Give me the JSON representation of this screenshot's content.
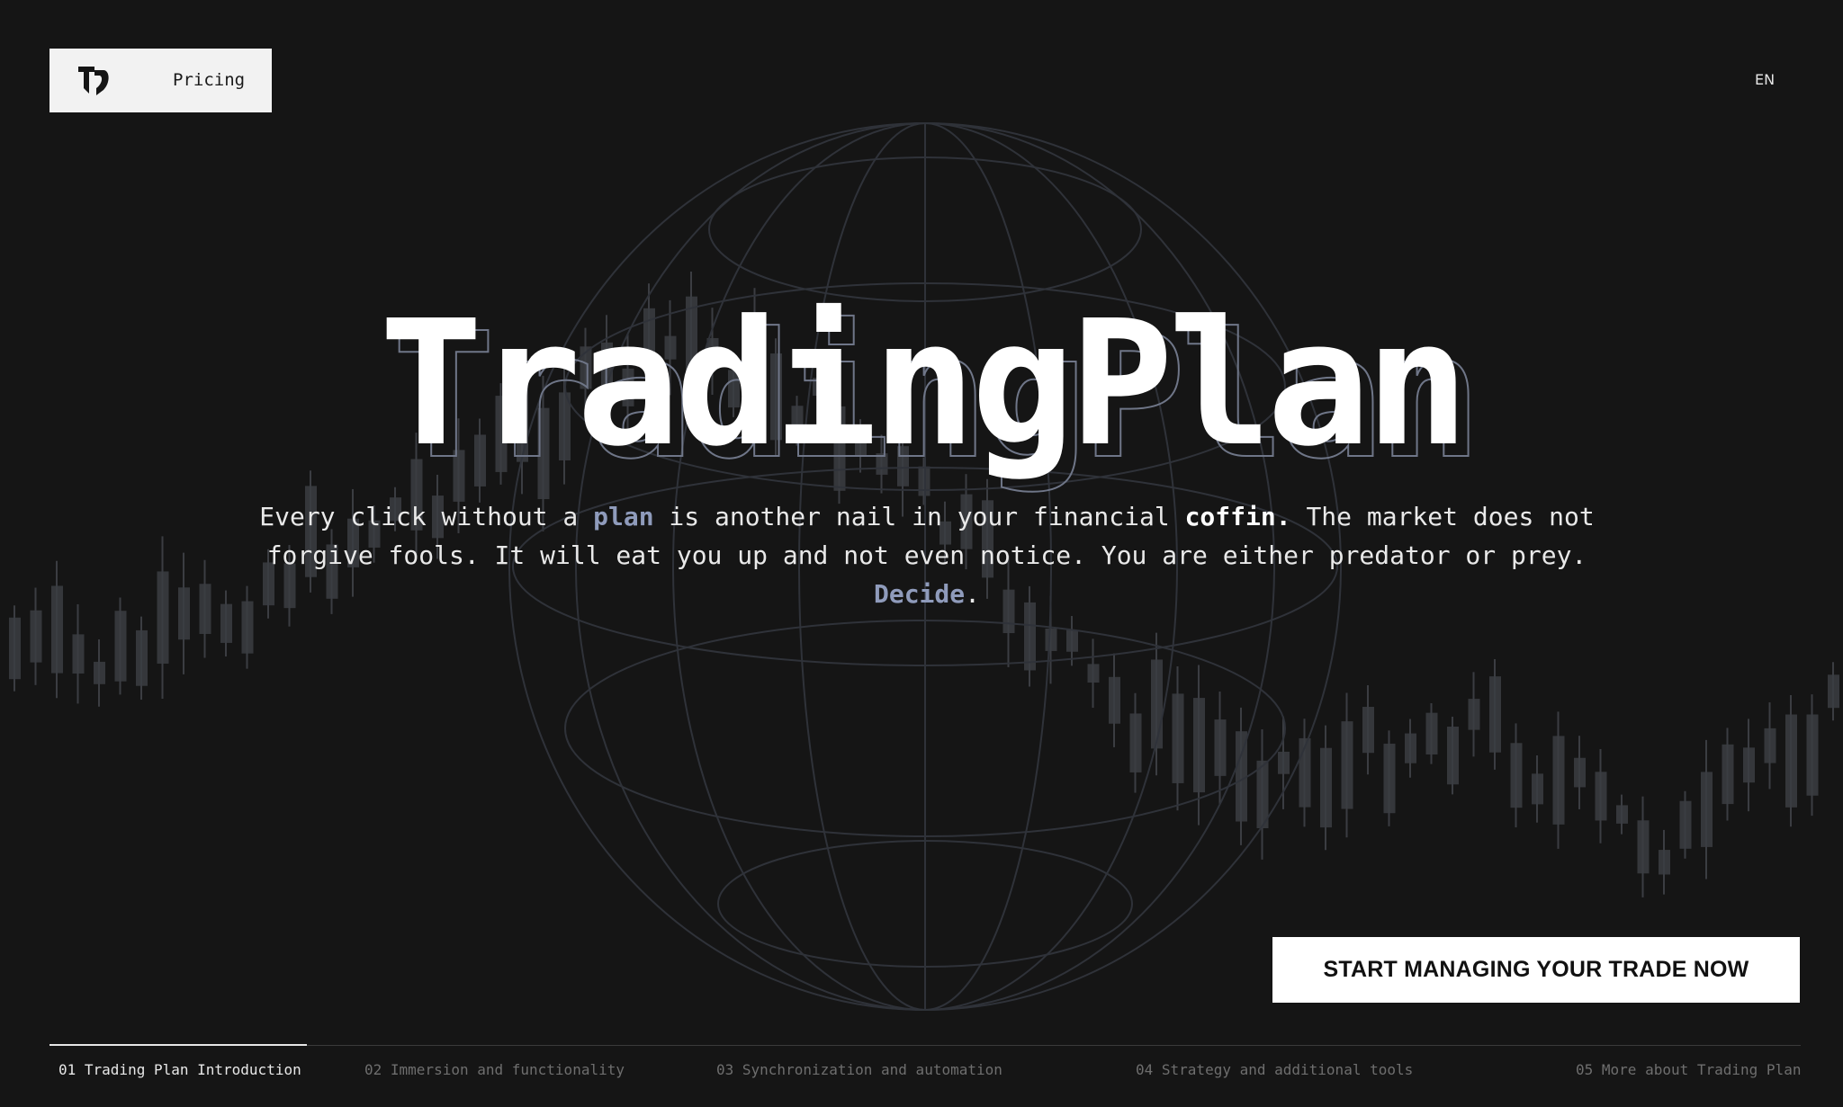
{
  "nav": {
    "logo_icon": "tp-monogram-icon",
    "pricing_label": "Pricing",
    "language": "EN"
  },
  "hero": {
    "title": "TradingPlan",
    "tagline": {
      "p1": "Every click without a ",
      "w_plan": "plan",
      "p2": " is another nail in your financial ",
      "w_coffin": "coffin.",
      "p3": " The market does not forgive fools. It will eat you up and not even notice. You are either predator or prey. ",
      "w_decide": "Decide",
      "p4": "."
    },
    "cta_label": "START MANAGING YOUR TRADE NOW"
  },
  "steps": [
    {
      "label": "01 Trading Plan Introduction",
      "active": true
    },
    {
      "label": "02 Immersion and functionality",
      "active": false
    },
    {
      "label": "03 Synchronization and automation",
      "active": false
    },
    {
      "label": "04 Strategy and additional tools",
      "active": false
    },
    {
      "label": "05 More about Trading Plan",
      "active": false
    }
  ],
  "progress": 0.147,
  "colors": {
    "background": "#151515",
    "accent": "#8f9bbb",
    "candle": "#3b3d42",
    "globe_lines": "#2f3239"
  }
}
